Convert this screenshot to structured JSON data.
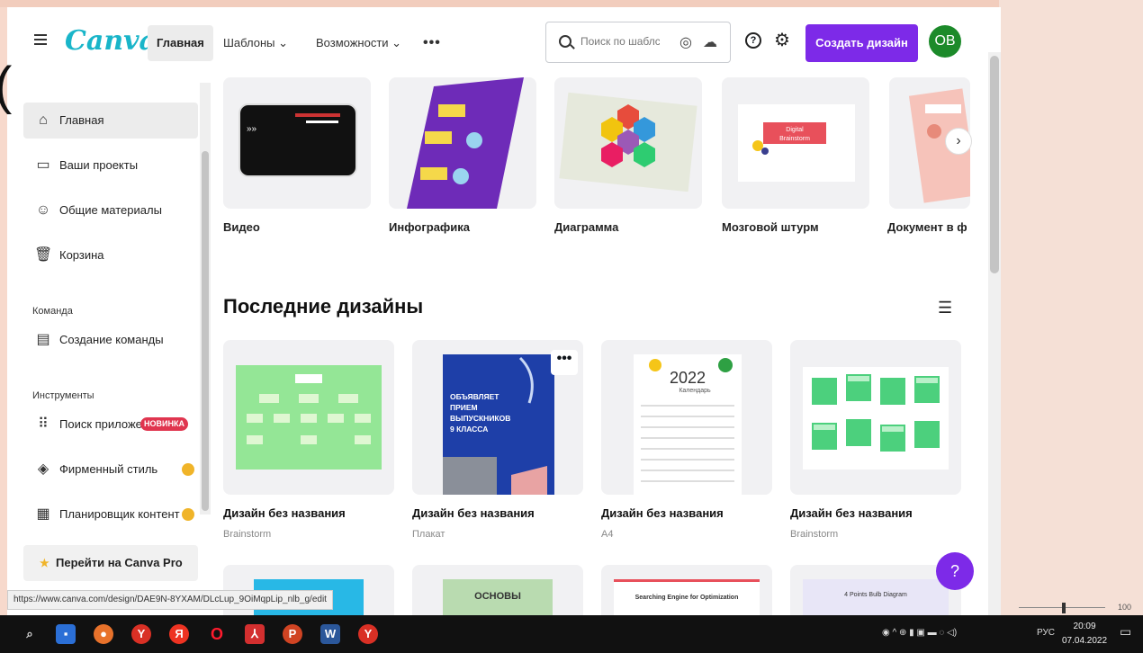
{
  "header": {
    "logo": "Canva",
    "nav_home": "Главная",
    "nav_templates": "Шаблоны ⌄",
    "nav_features": "Возможности ⌄",
    "nav_more": "•••",
    "search_placeholder": "Поиск по шаблс",
    "create_button": "Создать дизайн",
    "avatar_initials": "OB"
  },
  "sidebar": {
    "items": [
      {
        "label": "Главная",
        "icon": "home-icon"
      },
      {
        "label": "Ваши проекты",
        "icon": "folder-icon"
      },
      {
        "label": "Общие материалы",
        "icon": "people-icon"
      },
      {
        "label": "Корзина",
        "icon": "trash-icon"
      }
    ],
    "team_section": "Команда",
    "team_create": "Создание команды",
    "tools_section": "Инструменты",
    "tools": [
      {
        "label": "Поиск приложе",
        "badge": "НОВИНКА"
      },
      {
        "label": "Фирменный стиль"
      },
      {
        "label": "Планировщик контент"
      }
    ],
    "pro_button": "Перейти на Canva Pro"
  },
  "categories": [
    {
      "label": "Видео"
    },
    {
      "label": "Инфографика"
    },
    {
      "label": "Диаграмма"
    },
    {
      "label": "Мозговой штурм",
      "card_text": "Digital Brainstorm"
    },
    {
      "label": "Документ в ф"
    }
  ],
  "recent": {
    "title": "Последние дизайны",
    "designs": [
      {
        "title": "Дизайн без названия",
        "type": "Brainstorm"
      },
      {
        "title": "Дизайн без названия",
        "type": "Плакат",
        "poster_text": "ОБЪЯВЛЯЕТ ПРИЕМ ВЫПУСКНИКОВ 9 КЛАССА"
      },
      {
        "title": "Дизайн без названия",
        "type": "A4",
        "calendar_year": "2022",
        "calendar_word": "Календарь"
      },
      {
        "title": "Дизайн без названия",
        "type": "Brainstorm"
      }
    ],
    "row2": [
      {
        "text": ""
      },
      {
        "text": "ОСНОВЫ"
      },
      {
        "text": "Searching Engine for Optimization"
      },
      {
        "text": "4 Points Bulb Diagram"
      }
    ]
  },
  "help_fab": "?",
  "status_url": "https://www.canva.com/design/DAE9N-8YXAM/DLcLup_9OiMqpLip_nlb_g/edit",
  "zoom": {
    "percent": "100"
  },
  "taskbar": {
    "lang": "РУС",
    "time": "20:09",
    "date": "07.04.2022"
  },
  "colors": {
    "accent": "#7d2ae8",
    "logo": "#19b5c9",
    "avatar": "#1c8a2a",
    "badge": "#e0354f"
  }
}
